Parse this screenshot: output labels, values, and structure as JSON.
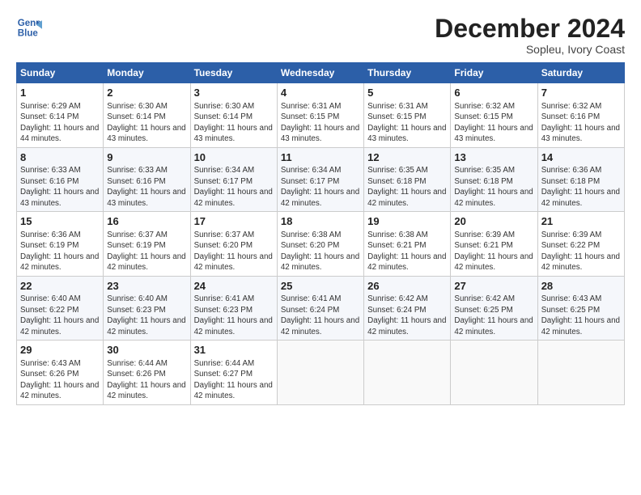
{
  "logo": {
    "line1": "General",
    "line2": "Blue"
  },
  "title": "December 2024",
  "subtitle": "Sopleu, Ivory Coast",
  "days_of_week": [
    "Sunday",
    "Monday",
    "Tuesday",
    "Wednesday",
    "Thursday",
    "Friday",
    "Saturday"
  ],
  "weeks": [
    [
      {
        "day": "1",
        "sunrise": "6:29 AM",
        "sunset": "6:14 PM",
        "daylight": "11 hours and 44 minutes."
      },
      {
        "day": "2",
        "sunrise": "6:30 AM",
        "sunset": "6:14 PM",
        "daylight": "11 hours and 43 minutes."
      },
      {
        "day": "3",
        "sunrise": "6:30 AM",
        "sunset": "6:14 PM",
        "daylight": "11 hours and 43 minutes."
      },
      {
        "day": "4",
        "sunrise": "6:31 AM",
        "sunset": "6:15 PM",
        "daylight": "11 hours and 43 minutes."
      },
      {
        "day": "5",
        "sunrise": "6:31 AM",
        "sunset": "6:15 PM",
        "daylight": "11 hours and 43 minutes."
      },
      {
        "day": "6",
        "sunrise": "6:32 AM",
        "sunset": "6:15 PM",
        "daylight": "11 hours and 43 minutes."
      },
      {
        "day": "7",
        "sunrise": "6:32 AM",
        "sunset": "6:16 PM",
        "daylight": "11 hours and 43 minutes."
      }
    ],
    [
      {
        "day": "8",
        "sunrise": "6:33 AM",
        "sunset": "6:16 PM",
        "daylight": "11 hours and 43 minutes."
      },
      {
        "day": "9",
        "sunrise": "6:33 AM",
        "sunset": "6:16 PM",
        "daylight": "11 hours and 43 minutes."
      },
      {
        "day": "10",
        "sunrise": "6:34 AM",
        "sunset": "6:17 PM",
        "daylight": "11 hours and 42 minutes."
      },
      {
        "day": "11",
        "sunrise": "6:34 AM",
        "sunset": "6:17 PM",
        "daylight": "11 hours and 42 minutes."
      },
      {
        "day": "12",
        "sunrise": "6:35 AM",
        "sunset": "6:18 PM",
        "daylight": "11 hours and 42 minutes."
      },
      {
        "day": "13",
        "sunrise": "6:35 AM",
        "sunset": "6:18 PM",
        "daylight": "11 hours and 42 minutes."
      },
      {
        "day": "14",
        "sunrise": "6:36 AM",
        "sunset": "6:18 PM",
        "daylight": "11 hours and 42 minutes."
      }
    ],
    [
      {
        "day": "15",
        "sunrise": "6:36 AM",
        "sunset": "6:19 PM",
        "daylight": "11 hours and 42 minutes."
      },
      {
        "day": "16",
        "sunrise": "6:37 AM",
        "sunset": "6:19 PM",
        "daylight": "11 hours and 42 minutes."
      },
      {
        "day": "17",
        "sunrise": "6:37 AM",
        "sunset": "6:20 PM",
        "daylight": "11 hours and 42 minutes."
      },
      {
        "day": "18",
        "sunrise": "6:38 AM",
        "sunset": "6:20 PM",
        "daylight": "11 hours and 42 minutes."
      },
      {
        "day": "19",
        "sunrise": "6:38 AM",
        "sunset": "6:21 PM",
        "daylight": "11 hours and 42 minutes."
      },
      {
        "day": "20",
        "sunrise": "6:39 AM",
        "sunset": "6:21 PM",
        "daylight": "11 hours and 42 minutes."
      },
      {
        "day": "21",
        "sunrise": "6:39 AM",
        "sunset": "6:22 PM",
        "daylight": "11 hours and 42 minutes."
      }
    ],
    [
      {
        "day": "22",
        "sunrise": "6:40 AM",
        "sunset": "6:22 PM",
        "daylight": "11 hours and 42 minutes."
      },
      {
        "day": "23",
        "sunrise": "6:40 AM",
        "sunset": "6:23 PM",
        "daylight": "11 hours and 42 minutes."
      },
      {
        "day": "24",
        "sunrise": "6:41 AM",
        "sunset": "6:23 PM",
        "daylight": "11 hours and 42 minutes."
      },
      {
        "day": "25",
        "sunrise": "6:41 AM",
        "sunset": "6:24 PM",
        "daylight": "11 hours and 42 minutes."
      },
      {
        "day": "26",
        "sunrise": "6:42 AM",
        "sunset": "6:24 PM",
        "daylight": "11 hours and 42 minutes."
      },
      {
        "day": "27",
        "sunrise": "6:42 AM",
        "sunset": "6:25 PM",
        "daylight": "11 hours and 42 minutes."
      },
      {
        "day": "28",
        "sunrise": "6:43 AM",
        "sunset": "6:25 PM",
        "daylight": "11 hours and 42 minutes."
      }
    ],
    [
      {
        "day": "29",
        "sunrise": "6:43 AM",
        "sunset": "6:26 PM",
        "daylight": "11 hours and 42 minutes."
      },
      {
        "day": "30",
        "sunrise": "6:44 AM",
        "sunset": "6:26 PM",
        "daylight": "11 hours and 42 minutes."
      },
      {
        "day": "31",
        "sunrise": "6:44 AM",
        "sunset": "6:27 PM",
        "daylight": "11 hours and 42 minutes."
      },
      null,
      null,
      null,
      null
    ]
  ]
}
